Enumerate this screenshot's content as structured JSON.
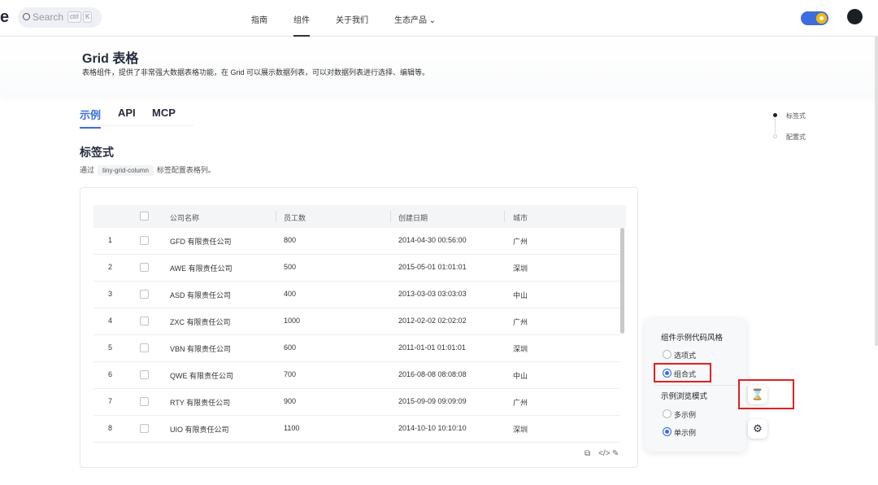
{
  "header": {
    "logo": "e",
    "search_placeholder": "Search",
    "kbd1": "ctrl",
    "kbd2": "K",
    "nav": [
      "指南",
      "组件",
      "关于我们",
      "生态产品"
    ]
  },
  "page": {
    "title": "Grid 表格",
    "desc": "表格组件，提供了非常强大数据表格功能，在 Grid 可以展示数据列表，可以对数据列表进行选择、编辑等。"
  },
  "tabs": [
    "示例",
    "API",
    "MCP"
  ],
  "section": {
    "title": "标签式",
    "desc_pre": "通过",
    "code": "tiny-grid-column",
    "desc_post": "标签配置表格列。"
  },
  "table": {
    "headers": [
      "公司名称",
      "员工数",
      "创建日期",
      "城市"
    ],
    "rows": [
      [
        "1",
        "GFD 有限责任公司",
        "800",
        "2014-04-30 00:56:00",
        "广州"
      ],
      [
        "2",
        "AWE 有限责任公司",
        "500",
        "2015-05-01 01:01:01",
        "深圳"
      ],
      [
        "3",
        "ASD 有限责任公司",
        "400",
        "2013-03-03 03:03:03",
        "中山"
      ],
      [
        "4",
        "ZXC 有限责任公司",
        "1000",
        "2012-02-02 02:02:02",
        "广州"
      ],
      [
        "5",
        "VBN 有限责任公司",
        "600",
        "2011-01-01 01:01:01",
        "深圳"
      ],
      [
        "6",
        "QWE 有限责任公司",
        "700",
        "2016-08-08 08:08:08",
        "中山"
      ],
      [
        "7",
        "RTY 有限责任公司",
        "900",
        "2015-09-09 09:09:09",
        "广州"
      ],
      [
        "8",
        "UIO 有限责任公司",
        "1100",
        "2014-10-10 10:10:10",
        "深圳"
      ]
    ]
  },
  "anchors": [
    "标签式",
    "配置式"
  ],
  "panel": {
    "style_title": "组件示例代码风格",
    "options": [
      "选项式",
      "组合式"
    ],
    "mode_title": "示例浏览模式",
    "modes": [
      "多示例",
      "单示例"
    ]
  }
}
